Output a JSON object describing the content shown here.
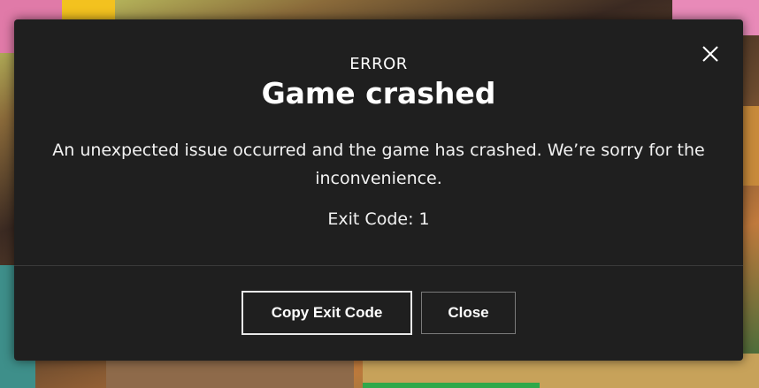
{
  "dialog": {
    "eyebrow": "ERROR",
    "title": "Game crashed",
    "message": "An unexpected issue occurred and the game has crashed. We’re sorry for the inconvenience.",
    "exit_code": "Exit Code: 1",
    "buttons": {
      "copy_label": "Copy Exit Code",
      "close_label": "Close"
    }
  },
  "icons": {
    "close": "close-icon"
  },
  "colors": {
    "dialog_bg": "#1f1f1f",
    "text": "#ffffff",
    "divider": "#3a3a3a",
    "primary_button_border": "#e8e8e8",
    "secondary_button_border": "#7a7a7a"
  }
}
